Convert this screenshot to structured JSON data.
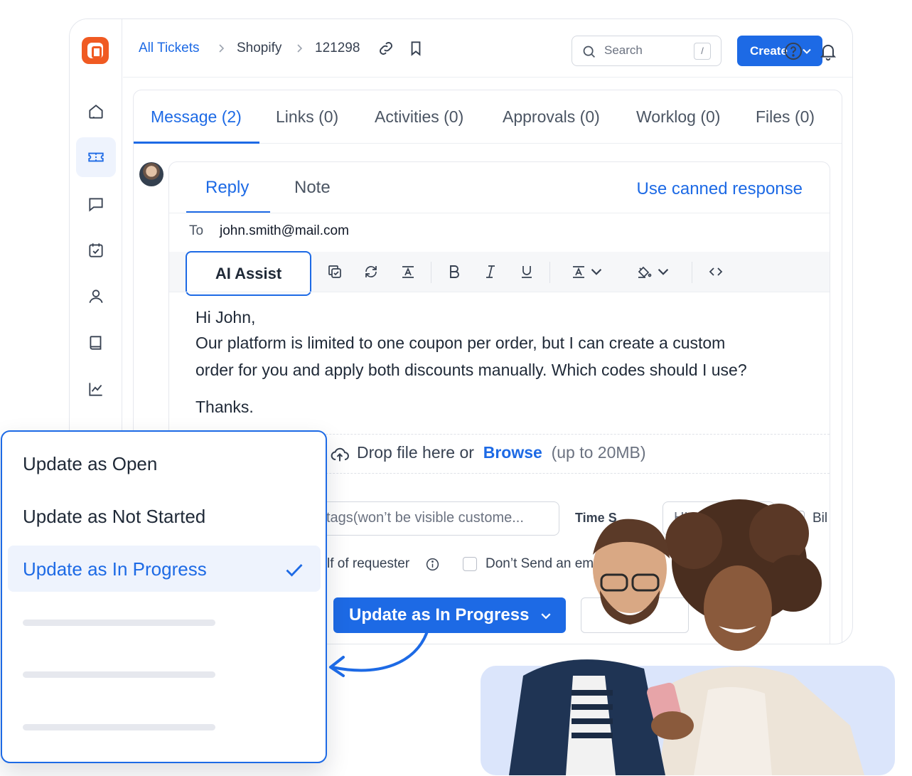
{
  "breadcrumb": {
    "root": "All Tickets",
    "company": "Shopify",
    "ticket_id": "121298"
  },
  "search": {
    "placeholder": "Search",
    "shortcut": "/"
  },
  "header": {
    "create_label": "Create"
  },
  "tabs": [
    {
      "label": "Message (2)",
      "active": true
    },
    {
      "label": "Links (0)"
    },
    {
      "label": "Activities (0)"
    },
    {
      "label": "Approvals (0)"
    },
    {
      "label": "Worklog (0)"
    },
    {
      "label": "Files (0)"
    }
  ],
  "reply": {
    "tabs": [
      "Reply",
      "Note"
    ],
    "canned_label": "Use canned response",
    "to_label": "To",
    "to_value": "john.smith@mail.com",
    "ai_assist_label": "AI Assist",
    "message": {
      "greeting": "Hi John,",
      "line1": "Our platform is limited to one coupon per order, but I can create a custom",
      "line2": "order for you and apply both discounts manually. Which codes should I use?",
      "signoff": "Thanks."
    },
    "drop": {
      "text": "Drop file here or",
      "browse": "Browse",
      "hint": "(up to 20MB)"
    },
    "tags_placeholder": "tags(won’t be visible custome...",
    "time_label": "Time S",
    "time_placeholder": "HH:MM",
    "bill_label": "Bil",
    "behalf_label": "lf of requester",
    "no_send_label": "Don’t Send an ema",
    "update_button": "Update as In Progress"
  },
  "status_menu": {
    "options": [
      {
        "label": "Update as Open"
      },
      {
        "label": "Update as Not Started"
      },
      {
        "label": "Update as In Progress",
        "selected": true
      }
    ]
  },
  "colors": {
    "accent": "#1d6ae5",
    "brand": "#f05a22",
    "selected_bg": "#eef3fd"
  },
  "icons": {
    "sidebar": [
      "home-icon",
      "ticket-icon",
      "chat-icon",
      "calendar-check-icon",
      "user-icon",
      "book-icon",
      "chart-icon"
    ],
    "toolbar": [
      "copy-icon",
      "refresh-icon",
      "text-format-icon",
      "bold-icon",
      "italic-icon",
      "underline-icon",
      "font-color-icon",
      "highlight-icon",
      "code-icon"
    ]
  }
}
